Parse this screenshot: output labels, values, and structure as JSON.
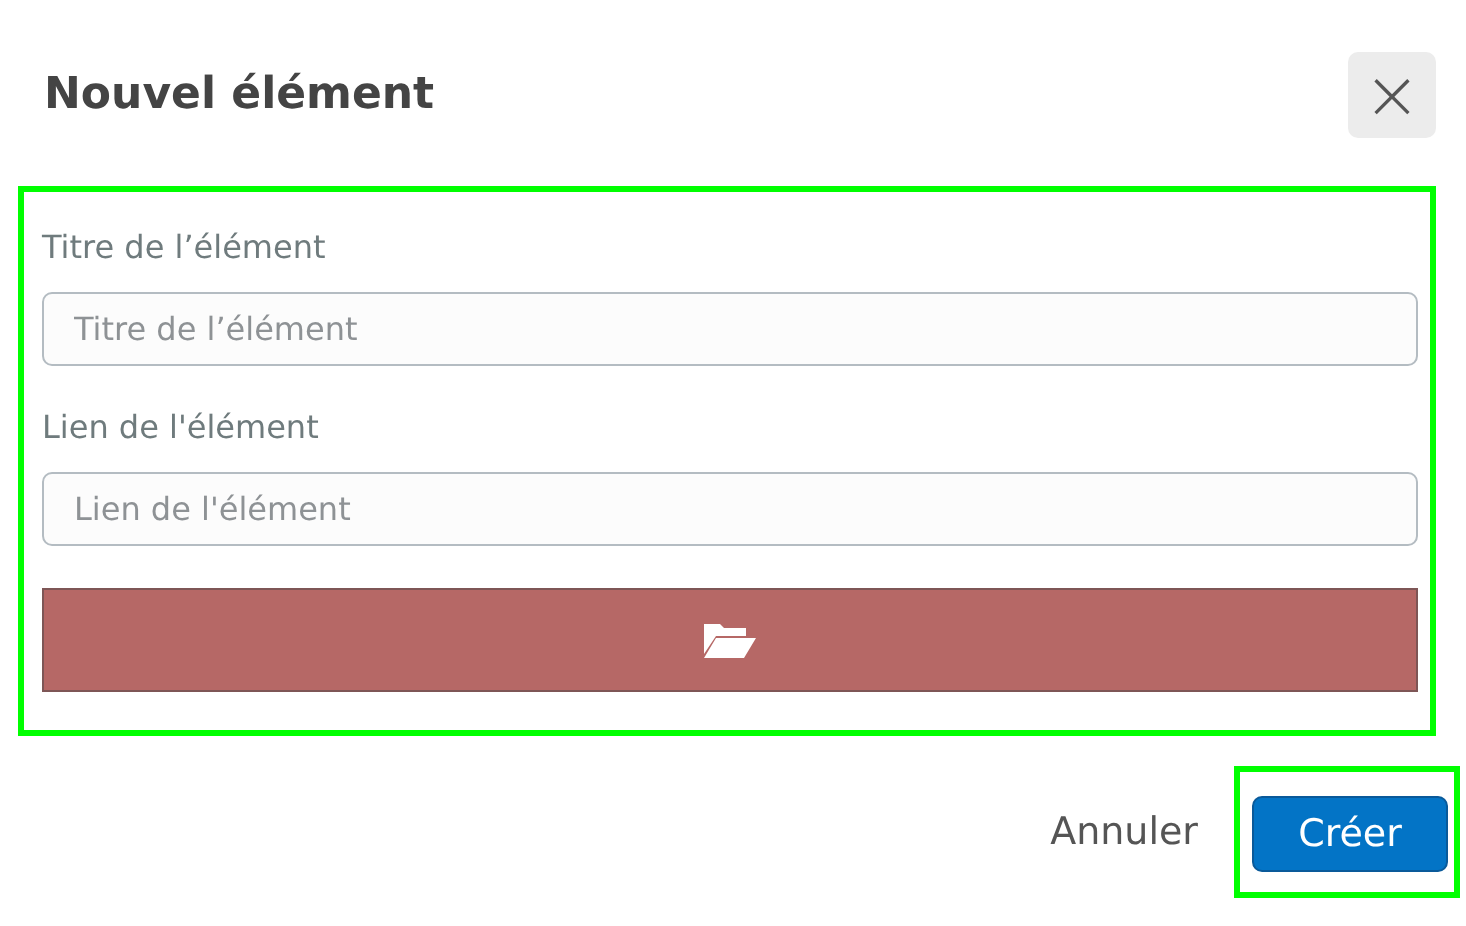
{
  "dialog": {
    "title": "Nouvel élément",
    "close_icon": "×"
  },
  "fields": [
    {
      "label": "Titre de l’élément",
      "placeholder": "Titre de l’élément"
    },
    {
      "label": "Lien de l'élément",
      "placeholder": "Lien de l'élément"
    }
  ],
  "buttons": [
    {
      "label": "Annuler",
      "kind": "secondary"
    },
    {
      "label": "Créer",
      "kind": "primary"
    }
  ]
}
